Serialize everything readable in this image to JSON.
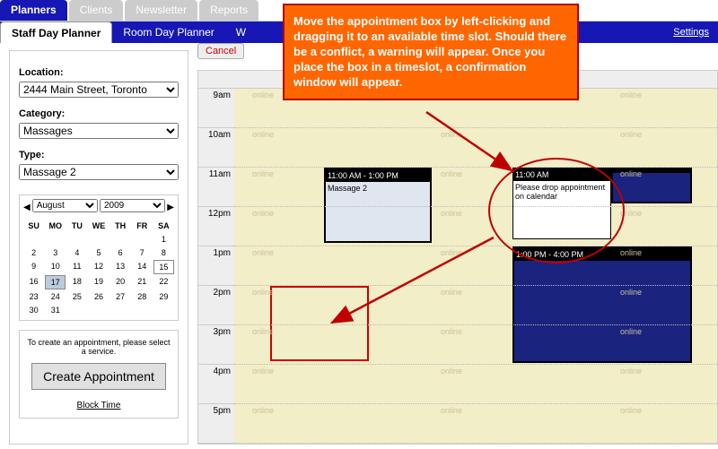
{
  "topTabs": [
    "Planners",
    "Clients",
    "Newsletter",
    "Reports"
  ],
  "subTabs": [
    "Staff Day Planner",
    "Room Day Planner",
    "W"
  ],
  "settingsLabel": "Settings",
  "sidebar": {
    "locationLabel": "Location:",
    "locationValue": "2444 Main Street, Toronto",
    "categoryLabel": "Category:",
    "categoryValue": "Massages",
    "typeLabel": "Type:",
    "typeValue": "Massage 2",
    "monthValue": "August",
    "yearValue": "2009",
    "daysHead": [
      "SU",
      "MO",
      "TU",
      "WE",
      "TH",
      "FR",
      "SA"
    ],
    "days": [
      "",
      "",
      "",
      "",
      "",
      "",
      "1",
      "2",
      "3",
      "4",
      "5",
      "6",
      "7",
      "8",
      "9",
      "10",
      "11",
      "12",
      "13",
      "14",
      "15",
      "16",
      "17",
      "18",
      "19",
      "20",
      "21",
      "22",
      "23",
      "24",
      "25",
      "26",
      "27",
      "28",
      "29",
      "30",
      "31"
    ],
    "createHint": "To create an appointment, please select a service.",
    "createBtn": "Create Appointment",
    "blockTime": "Block Time"
  },
  "cancelLabel": "Cancel",
  "times": [
    "9am",
    "10am",
    "11am",
    "12pm",
    "1pm",
    "2pm",
    "3pm",
    "4pm",
    "5pm"
  ],
  "watermark": "online",
  "appt1": {
    "header": "11:00 AM - 1:00 PM",
    "body": "Massage 2"
  },
  "tooltip": {
    "header": "11:00 AM",
    "body": "Please drop appointment on calendar"
  },
  "appt2": {
    "header": "1:00 PM - 4:00 PM"
  },
  "calloutText": "Move the appointment box by left-clicking and dragging it to an available time slot.  Should there be a conflict, a warning will appear.  Once you place the box in a timeslot, a confirmation window will appear."
}
